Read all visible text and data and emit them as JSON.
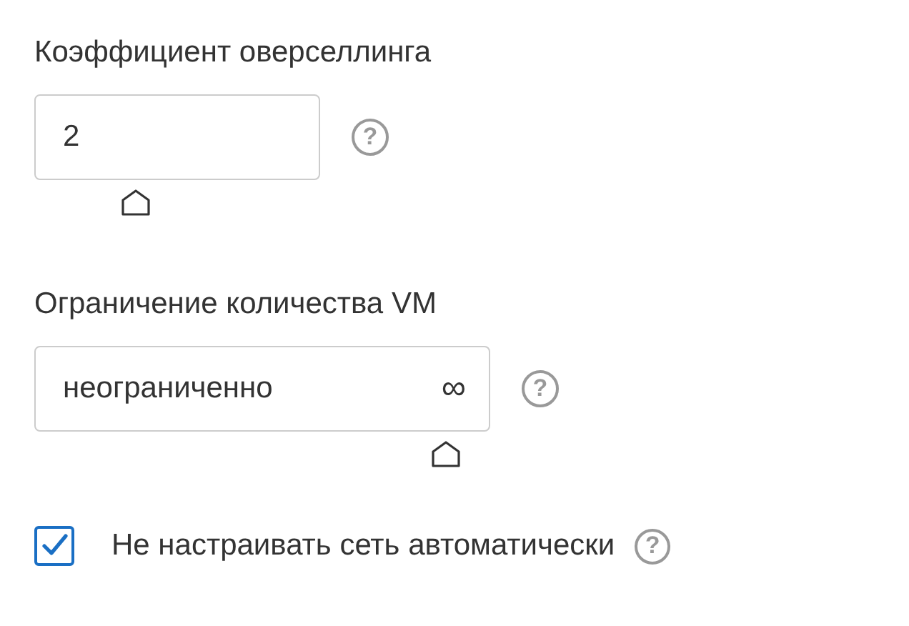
{
  "fields": [
    {
      "label": "Коэффициент оверселлинга",
      "value": "2",
      "help": "?",
      "kind": "short"
    },
    {
      "label": "Ограничение количества VM",
      "value": "неограниченно",
      "suffix": "∞",
      "help": "?",
      "kind": "wide"
    }
  ],
  "checkbox": {
    "label": "Не настраивать сеть автоматически",
    "checked": true,
    "help": "?"
  }
}
